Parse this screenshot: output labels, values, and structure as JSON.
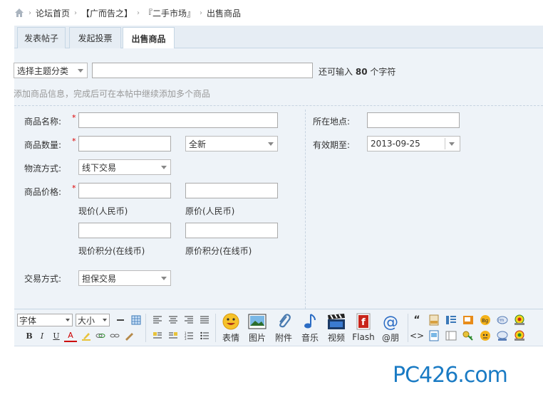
{
  "breadcrumb": {
    "items": [
      "论坛首页",
      "【广而告之】",
      "『二手市场』",
      "出售商品"
    ]
  },
  "tabs": [
    {
      "label": "发表帖子",
      "active": false
    },
    {
      "label": "发起投票",
      "active": false
    },
    {
      "label": "出售商品",
      "active": true
    }
  ],
  "topic": {
    "category_value": "选择主题分类",
    "title_value": "",
    "remain_prefix": "还可输入",
    "remain_count": "80",
    "remain_suffix": "个字符"
  },
  "hint": "添加商品信息，完成后可在本帖中继续添加多个商品",
  "form": {
    "name_label": "商品名称:",
    "qty_label": "商品数量:",
    "condition_value": "全新",
    "logistics_label": "物流方式:",
    "logistics_value": "线下交易",
    "price_label": "商品价格:",
    "price_now_caption": "现价(人民币)",
    "price_orig_caption": "原价(人民币)",
    "credit_now_caption": "现价积分(在线币)",
    "credit_orig_caption": "原价积分(在线币)",
    "trade_label": "交易方式:",
    "trade_value": "担保交易",
    "location_label": "所在地点:",
    "expire_label": "有效期至:",
    "expire_value": "2013-09-25",
    "required_mark": "*"
  },
  "editor": {
    "font_value": "字体",
    "size_value": "大小",
    "bold": "B",
    "italic": "I",
    "underline": "U",
    "fontcolor": "A",
    "big_buttons": [
      "表情",
      "图片",
      "附件",
      "音乐",
      "视频",
      "Flash",
      "@朋"
    ]
  },
  "watermark": "PC426.com",
  "colors": {
    "accent": "#1a7bc4",
    "required": "#d00000",
    "panel": "#eef3f8"
  }
}
